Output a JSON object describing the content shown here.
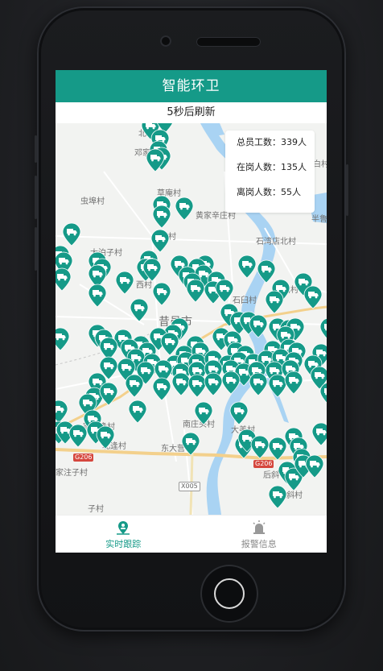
{
  "app": {
    "title": "智能环卫",
    "refresh_text": "5秒后刷新"
  },
  "stats": {
    "total_label": "总员工数：",
    "total_value": "339人",
    "on_duty_label": "在岗人数：",
    "on_duty_value": "135人",
    "off_duty_label": "离岗人数：",
    "off_duty_value": "55人"
  },
  "map": {
    "city_label": "昔邑市",
    "places": [
      "北",
      "邓家",
      "草庵村",
      "虫埠村",
      "黄家辛庄村",
      "家村",
      "大泊子村",
      "石湾店北村",
      "初曲村",
      "石臼村",
      "西村",
      "南庄头村",
      "大美村",
      "东大营",
      "北逢村",
      "家注子村",
      "后斜",
      "戚斜村",
      "家北逢村",
      "子村",
      "半鲁",
      "白村"
    ],
    "road_labels": [
      "G206",
      "G206",
      "X005"
    ]
  },
  "tabs": [
    {
      "label": "实时跟踪",
      "icon": "map-pin-person-icon",
      "active": true
    },
    {
      "label": "报警信息",
      "icon": "alarm-light-icon",
      "active": false
    }
  ],
  "colors": {
    "primary": "#159a88",
    "pin": "#159a88",
    "water": "#a9d3f3"
  }
}
